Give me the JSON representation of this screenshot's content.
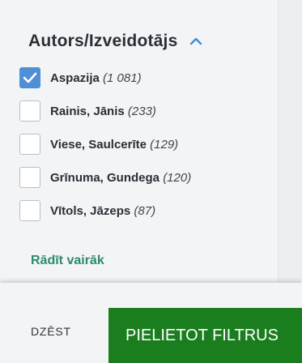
{
  "facet": {
    "title": "Autors/Izveidotājs",
    "items": [
      {
        "name": "Aspazija",
        "count": "(1 081)",
        "checked": true
      },
      {
        "name": "Rainis, Jānis",
        "count": "(233)",
        "checked": false
      },
      {
        "name": "Viese, Saulcerīte",
        "count": "(129)",
        "checked": false
      },
      {
        "name": "Grīnuma, Gundega",
        "count": "(120)",
        "checked": false
      },
      {
        "name": "Vītols, Jāzeps",
        "count": "(87)",
        "checked": false
      }
    ],
    "show_more": "Rādīt vairāk"
  },
  "footer": {
    "clear_label": "DZĒST",
    "apply_label": "PIELIETOT FILTRUS"
  },
  "colors": {
    "accent_checkbox": "#4f8fd6",
    "link": "#2c8a6b",
    "apply_button": "#1a7e1f"
  },
  "icons": {
    "collapse": "chevron-up-icon",
    "check": "checkmark-icon"
  }
}
